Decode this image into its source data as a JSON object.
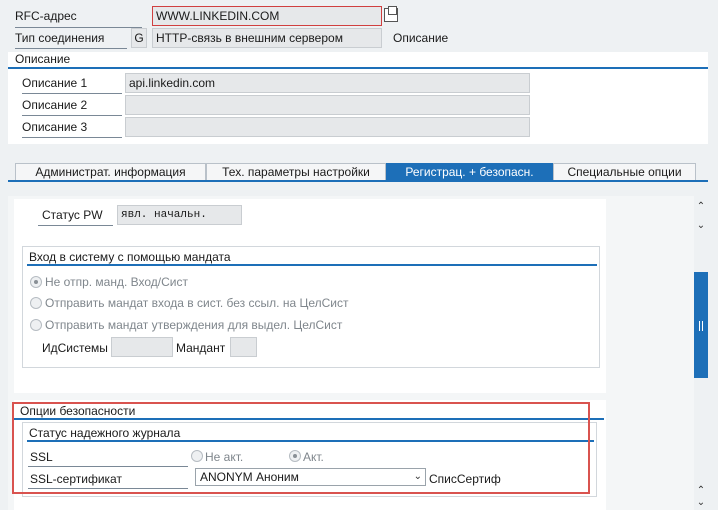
{
  "header": {
    "rfc_label": "RFC-адрес",
    "rfc_value": "WWW.LINKEDIN.COM",
    "conn_type_label": "Тип соединения",
    "conn_type_code": "G",
    "conn_type_value": "HTTP-связь в внешним сервером",
    "description_right": "Описание"
  },
  "description_section": {
    "title": "Описание",
    "rows": [
      {
        "label": "Описание 1",
        "value": "api.linkedin.com"
      },
      {
        "label": "Описание 2",
        "value": ""
      },
      {
        "label": "Описание 3",
        "value": ""
      }
    ]
  },
  "tabs": [
    {
      "label": "Администрат. информация",
      "active": false
    },
    {
      "label": "Тех. параметры настройки",
      "active": false
    },
    {
      "label": "Регистрац. + безопасн.",
      "active": true
    },
    {
      "label": "Специальные опции",
      "active": false
    }
  ],
  "status_pw": {
    "label": "Статус PW",
    "value": "явл. начальн."
  },
  "ticket_login": {
    "title": "Вход в систему с помощью мандата",
    "options": [
      {
        "label": "Не отпр. манд. Вход/Сист",
        "checked": true
      },
      {
        "label": "Отправить мандат входа в сист. без ссыл. на ЦелСист",
        "checked": false
      },
      {
        "label": "Отправить мандат утверждения для выдел. ЦелСист",
        "checked": false
      }
    ],
    "system_id_label": "ИдСистемы",
    "system_id_value": "",
    "client_label": "Мандант",
    "client_value": ""
  },
  "security_options": {
    "title": "Опции безопасности",
    "log_status_title": "Статус надежного журнала",
    "ssl_label": "SSL",
    "ssl_inactive_label": "Не акт.",
    "ssl_active_label": "Акт.",
    "ssl_selected": "Акт.",
    "cert_label": "SSL-сертификат",
    "cert_value": "ANONYM Аноним",
    "cert_list_label": "СписСертиф"
  },
  "colors": {
    "accent": "#1d6fb8",
    "highlight_box": "#d9534f"
  }
}
